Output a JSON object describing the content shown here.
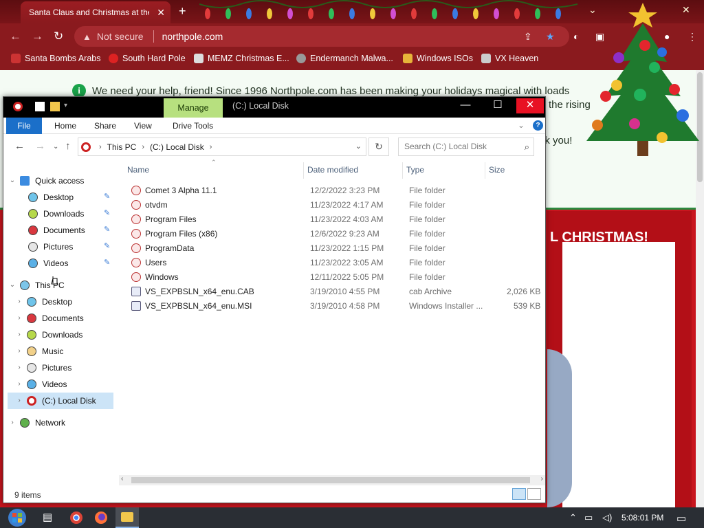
{
  "browser": {
    "tab_title": "Santa Claus and Christmas at the",
    "tab_close": "✕",
    "new_tab": "+",
    "omnibox": {
      "security": "Not secure",
      "url": "northpole.com"
    },
    "bookmarks": [
      {
        "label": "Santa Bombs Arabs"
      },
      {
        "label": "South Hard Pole"
      },
      {
        "label": "MEMZ Christmas E..."
      },
      {
        "label": "Endermanch Malwa..."
      },
      {
        "label": "Windows ISOs"
      },
      {
        "label": "VX Heaven"
      }
    ]
  },
  "website": {
    "banner_line1": "We need your help, friend! Since 1996 Northpole.com has been making your holidays magical with loads",
    "banner_line2": "the rising",
    "banner_line3": "nk you!",
    "xmas_heading": "L CHRISTMAS!"
  },
  "explorer": {
    "manage_tab": "Manage",
    "title": "(C:) Local Disk",
    "ribbon_tabs": [
      "File",
      "Home",
      "Share",
      "View",
      "Drive Tools"
    ],
    "breadcrumb": [
      "This PC",
      "(C:) Local Disk"
    ],
    "search_placeholder": "Search (C:) Local Disk",
    "nav": {
      "quick_access": "Quick access",
      "quick_items": [
        "Desktop",
        "Downloads",
        "Documents",
        "Pictures",
        "Videos"
      ],
      "this_pc": "This PC",
      "pc_items": [
        "Desktop",
        "Documents",
        "Downloads",
        "Music",
        "Pictures",
        "Videos",
        "(C:) Local Disk"
      ],
      "network": "Network"
    },
    "columns": {
      "name": "Name",
      "date": "Date modified",
      "type": "Type",
      "size": "Size"
    },
    "files": [
      {
        "name": "Comet 3 Alpha 11.1",
        "date": "12/2/2022 3:23 PM",
        "type": "File folder",
        "size": ""
      },
      {
        "name": "otvdm",
        "date": "11/23/2022 4:17 AM",
        "type": "File folder",
        "size": ""
      },
      {
        "name": "Program Files",
        "date": "11/23/2022 4:03 AM",
        "type": "File folder",
        "size": ""
      },
      {
        "name": "Program Files (x86)",
        "date": "12/6/2022 9:23 AM",
        "type": "File folder",
        "size": ""
      },
      {
        "name": "ProgramData",
        "date": "11/23/2022 1:15 PM",
        "type": "File folder",
        "size": ""
      },
      {
        "name": "Users",
        "date": "11/23/2022 3:05 AM",
        "type": "File folder",
        "size": ""
      },
      {
        "name": "Windows",
        "date": "12/11/2022 5:05 PM",
        "type": "File folder",
        "size": ""
      },
      {
        "name": "VS_EXPBSLN_x64_enu.CAB",
        "date": "3/19/2010 4:55 PM",
        "type": "cab Archive",
        "size": "2,026 KB"
      },
      {
        "name": "VS_EXPBSLN_x64_enu.MSI",
        "date": "3/19/2010 4:58 PM",
        "type": "Windows Installer ...",
        "size": "539 KB"
      }
    ],
    "status": "9 items"
  },
  "taskbar": {
    "clock": "5:08:01 PM"
  },
  "colors": {
    "chrome_red": "#8a1a1e",
    "ribbon_blue": "#1b6fc9",
    "manage_green": "#b7e07f",
    "close_red": "#e81123"
  }
}
